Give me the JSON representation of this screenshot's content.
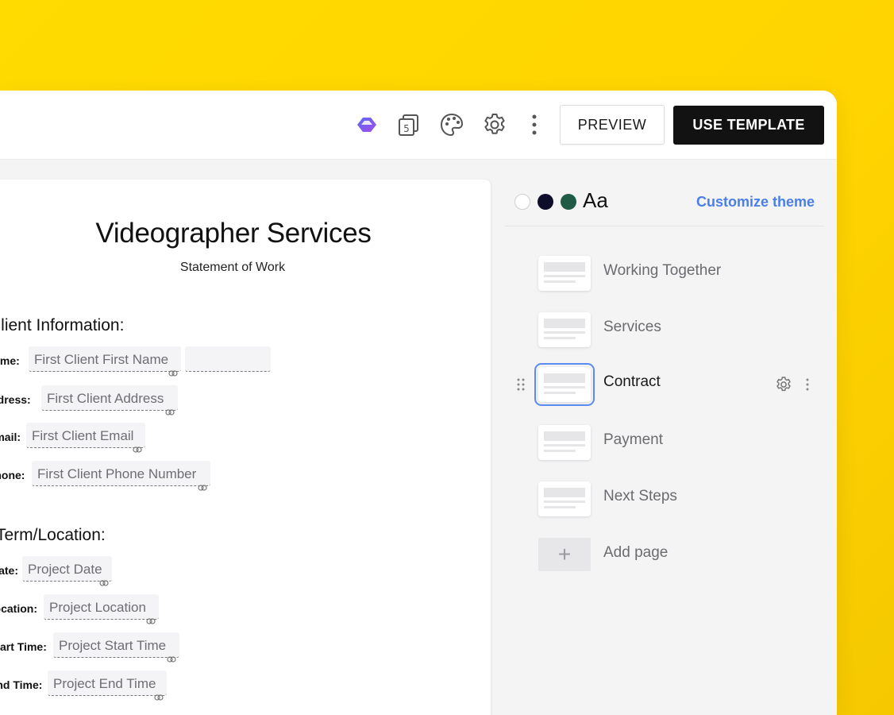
{
  "toolbar": {
    "icons": [
      "brand-logo-icon",
      "pages-count-icon",
      "palette-icon",
      "gear-icon",
      "more-vertical-icon"
    ],
    "pages_count": "5",
    "preview_label": "PREVIEW",
    "use_template_label": "USE TEMPLATE"
  },
  "document": {
    "title": "Videographer Services",
    "subtitle": "Statement of Work",
    "client_section": {
      "heading": "Client Information:",
      "fields": [
        {
          "label": "Name:",
          "value": "First Client First Name"
        },
        {
          "label": "Address:",
          "value": "First Client Address"
        },
        {
          "label": "Email:",
          "value": "First Client Email"
        },
        {
          "label": "Phone:",
          "value": "First Client Phone Number"
        }
      ]
    },
    "term_section": {
      "heading": "Term/Location:",
      "fields": [
        {
          "label": "Date:",
          "value": "Project Date"
        },
        {
          "label": "Location:",
          "value": "Project Location"
        },
        {
          "label": "Start Time:",
          "value": "Project Start Time"
        },
        {
          "label": "End Time:",
          "value": "Project End Time"
        }
      ]
    }
  },
  "theme": {
    "colors": [
      "#FFFFFF",
      "#0E0E2A",
      "#1F5B45"
    ],
    "font_sample": "Aa",
    "customize_label": "Customize theme"
  },
  "pages": [
    {
      "label": "Working Together",
      "selected": false
    },
    {
      "label": "Services",
      "selected": false
    },
    {
      "label": "Contract",
      "selected": true
    },
    {
      "label": "Payment",
      "selected": false
    },
    {
      "label": "Next Steps",
      "selected": false
    }
  ],
  "add_page_label": "Add page",
  "colors": {
    "background": "#FFD800",
    "accent": "#4A7FE8",
    "primary_button": "#121212"
  }
}
